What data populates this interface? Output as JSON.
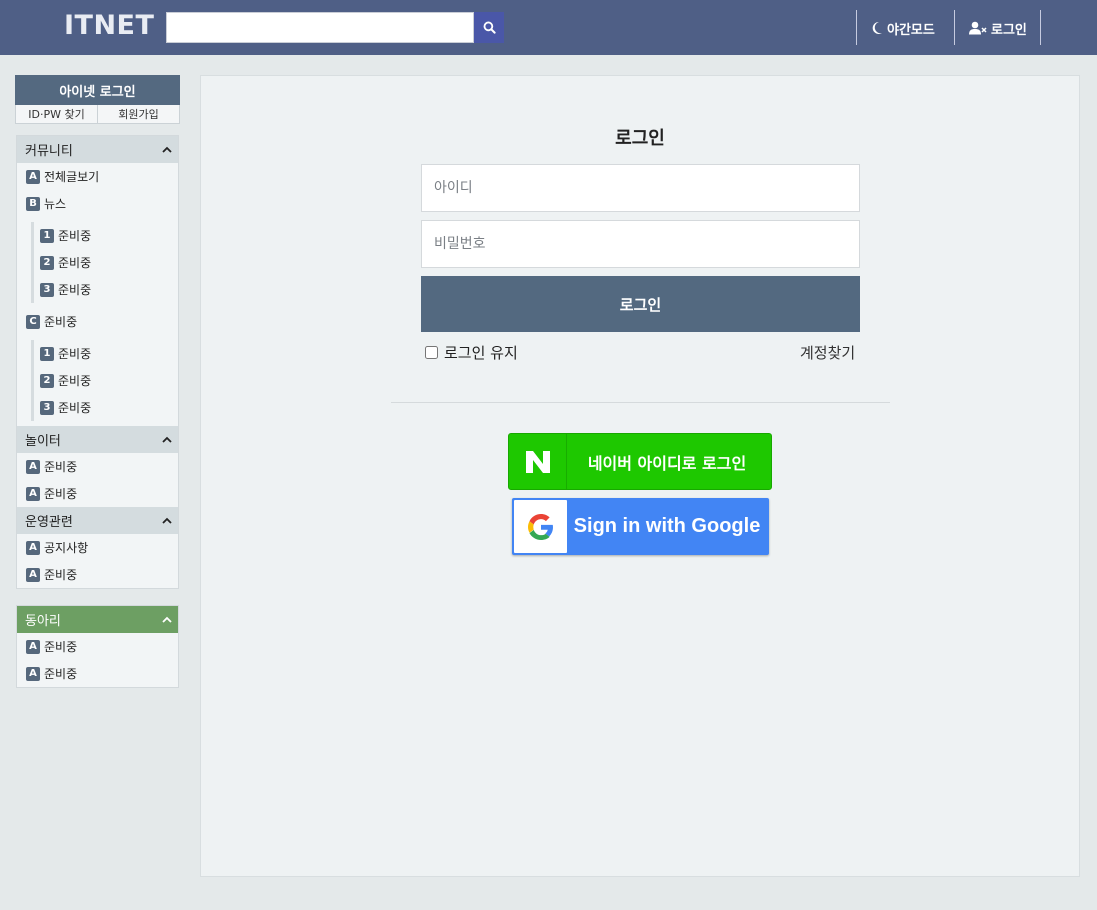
{
  "header": {
    "logo": "ITNET",
    "search": {
      "value": "",
      "placeholder": ""
    },
    "night_mode_label": "야간모드",
    "login_label": "로그인"
  },
  "sidebar": {
    "login_box": {
      "title": "아이넷 로그인",
      "find_id_pw": "ID·PW 찾기",
      "signup": "회원가입"
    },
    "sections": [
      {
        "title": "커뮤니티",
        "items": [
          {
            "badge": "A",
            "label": "전체글보기"
          },
          {
            "badge": "B",
            "label": "뉴스",
            "children": [
              {
                "badge": "1",
                "label": "준비중"
              },
              {
                "badge": "2",
                "label": "준비중"
              },
              {
                "badge": "3",
                "label": "준비중"
              }
            ]
          },
          {
            "badge": "C",
            "label": "준비중",
            "children": [
              {
                "badge": "1",
                "label": "준비중"
              },
              {
                "badge": "2",
                "label": "준비중"
              },
              {
                "badge": "3",
                "label": "준비중"
              }
            ]
          }
        ]
      },
      {
        "title": "놀이터",
        "items": [
          {
            "badge": "A",
            "label": "준비중"
          },
          {
            "badge": "A",
            "label": "준비중"
          }
        ]
      },
      {
        "title": "운영관련",
        "items": [
          {
            "badge": "A",
            "label": "공지사항"
          },
          {
            "badge": "A",
            "label": "준비중"
          }
        ]
      }
    ],
    "club": {
      "title": "동아리",
      "items": [
        {
          "badge": "A",
          "label": "준비중"
        },
        {
          "badge": "A",
          "label": "준비중"
        }
      ]
    }
  },
  "main": {
    "title": "로그인",
    "id_field": {
      "value": "",
      "placeholder": "아이디"
    },
    "pw_field": {
      "value": "",
      "placeholder": "비밀번호"
    },
    "submit_label": "로그인",
    "keep_login_label": "로그인 유지",
    "find_account_label": "계정찾기",
    "naver_label": "네이버 아이디로 로그인",
    "google_label": "Sign in with Google"
  },
  "colors": {
    "header_bg": "#4f5f86",
    "accent": "#536980",
    "naver_green": "#1ec800",
    "google_blue": "#4285f4",
    "club_green": "#6d9f63"
  }
}
